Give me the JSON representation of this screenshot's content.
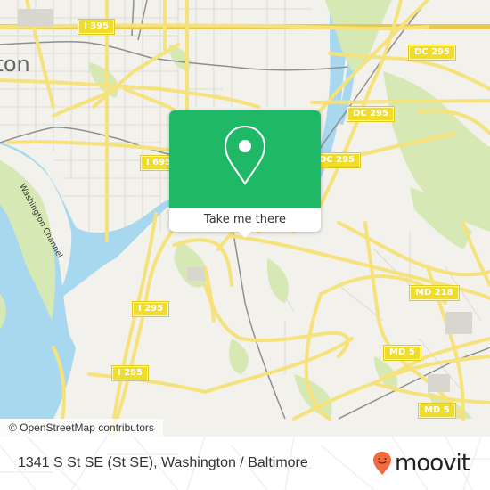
{
  "map": {
    "place_labels": [
      {
        "text": "ngton",
        "name": "city-label-washington"
      },
      {
        "text": "Washington Channel",
        "name": "water-label-washington-channel"
      }
    ],
    "shields": [
      {
        "text": "I 395",
        "name": "shield-i395"
      },
      {
        "text": "I 695",
        "name": "shield-i695"
      },
      {
        "text": "DC 295",
        "name": "shield-dc295-north"
      },
      {
        "text": "DC 295",
        "name": "shield-dc295-middle"
      },
      {
        "text": "DC 295",
        "name": "shield-dc295-south"
      },
      {
        "text": "I 295",
        "name": "shield-i295-north"
      },
      {
        "text": "I 295",
        "name": "shield-i295-south"
      },
      {
        "text": "MD 218",
        "name": "shield-md218"
      },
      {
        "text": "MD 5",
        "name": "shield-md5-north"
      },
      {
        "text": "MD 5",
        "name": "shield-md5-south"
      }
    ],
    "attribution": "© OpenStreetMap contributors",
    "colors": {
      "land": "#f2f1ec",
      "water": "#a8d8ef",
      "park": "#d6e8b4",
      "road": "#f6e27a",
      "road_edge": "#e8c94e",
      "rail": "#8f8f8f"
    }
  },
  "popup": {
    "icon": "map-pin-icon",
    "action_label": "Take me there",
    "color": "#1eb867"
  },
  "footer": {
    "address": "1341 S St SE (St SE), Washington / Baltimore",
    "brand": "moovit",
    "brand_color": "#f26a3d"
  }
}
